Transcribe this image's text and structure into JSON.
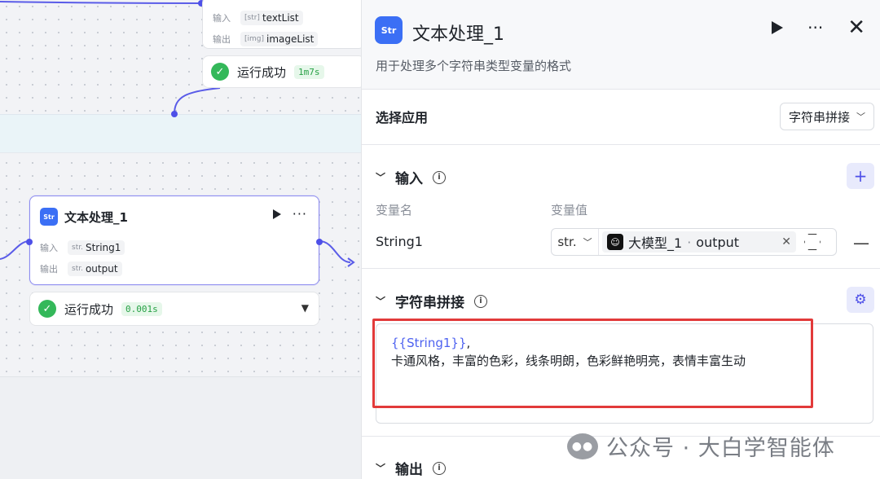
{
  "canvas": {
    "top_node": {
      "inputs": [
        {
          "key": "输入",
          "type": "[str]",
          "name": "textList"
        },
        {
          "key": "输出",
          "type": "[img]",
          "name": "imageList"
        }
      ],
      "status": {
        "text": "运行成功",
        "time": "1m7s"
      }
    },
    "main_node": {
      "title": "文本处理_1",
      "icon_text": "Str",
      "inputs": [
        {
          "key": "输入",
          "type": "str.",
          "name": "String1"
        },
        {
          "key": "输出",
          "type": "str.",
          "name": "output"
        }
      ],
      "status": {
        "text": "运行成功",
        "time": "0.001s"
      }
    }
  },
  "panel": {
    "title": "文本处理_1",
    "icon_text": "Str",
    "description": "用于处理多个字符串类型变量的格式",
    "app_section": {
      "label": "选择应用",
      "selected": "字符串拼接"
    },
    "input_section": {
      "title": "输入",
      "col_name": "变量名",
      "col_value": "变量值",
      "rows": [
        {
          "name": "String1",
          "type": "str.",
          "ref_node": "大模型_1",
          "ref_sep": " · ",
          "ref_field": "output"
        }
      ]
    },
    "concat_section": {
      "title": "字符串拼接",
      "template_var": "{{String1}}",
      "template_sep": ",",
      "template_text": "卡通风格，丰富的色彩，线条明朗，色彩鲜艳明亮，表情丰富生动"
    },
    "output_section": {
      "title": "输出"
    }
  },
  "watermark": {
    "text": "公众号 · 大白学智能体"
  }
}
